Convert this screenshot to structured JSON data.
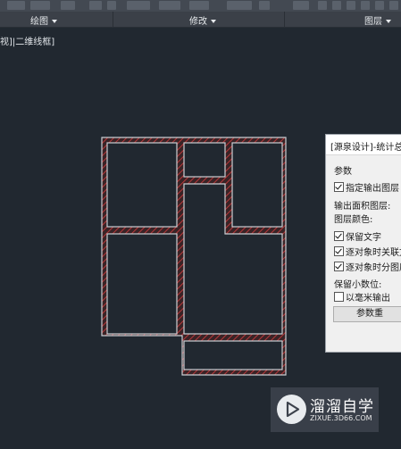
{
  "ribbon": {
    "panels": [
      {
        "label": "绘图"
      },
      {
        "label": "修改"
      },
      {
        "label": "图层"
      }
    ]
  },
  "viewport": {
    "label": "视]|二维线框]"
  },
  "dialog": {
    "title": "[源泉设计]-统计总",
    "section_label": "参数",
    "specify_output_layer": "指定输出图层",
    "output_area_layer_label": "输出面积图层:",
    "layer_color_label": "图层颜色:",
    "keep_text": "保留文字",
    "per_object_link": "逐对象时关联文",
    "per_object_layer": "逐对象时分图层",
    "decimal_label": "保留小数位:",
    "mm_output": "以毫米输出",
    "params_button": "参数重",
    "checks": {
      "specify_output_layer": true,
      "keep_text": true,
      "per_object_link": true,
      "per_object_layer": true,
      "mm_output": false
    }
  },
  "watermark": {
    "title": "溜溜自学",
    "url": "ZIXUE.3D66.COM",
    "logo_icon": "play-icon"
  },
  "colors": {
    "background": "#212830",
    "wall_outline": "#c9ced4",
    "wall_hatch": "#b8383a"
  }
}
